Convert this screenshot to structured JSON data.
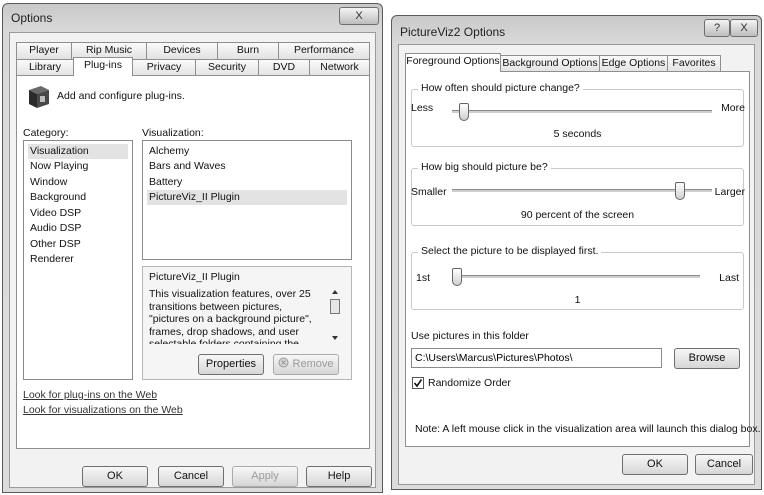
{
  "options": {
    "title": "Options",
    "close_glyph": "X",
    "tabs_back": [
      "Player",
      "Rip Music",
      "Devices",
      "Burn",
      "Performance"
    ],
    "tabs_front": [
      "Library",
      "Plug-ins",
      "Privacy",
      "Security",
      "DVD",
      "Network"
    ],
    "active_tab": "Plug-ins",
    "header_text": "Add and configure plug-ins.",
    "category_label": "Category:",
    "categories": [
      "Visualization",
      "Now Playing",
      "Window",
      "Background",
      "Video DSP",
      "Audio DSP",
      "Other DSP",
      "Renderer"
    ],
    "selected_category": "Visualization",
    "visualization_label": "Visualization:",
    "visualizations": [
      "Alchemy",
      "Bars and Waves",
      "Battery",
      "PictureViz_II Plugin"
    ],
    "selected_visualization": "PictureViz_II Plugin",
    "detail_title": "PictureViz_II Plugin",
    "detail_text": "This visualization features, over 25 transitions between pictures, \"pictures on a background picture\", frames, drop shadows, and user selectable folders containing the pictures to be displayed.",
    "properties_button": "Properties",
    "remove_button": "Remove",
    "link_plugins": "Look for plug-ins on the Web",
    "link_visualizations": "Look for visualizations on the Web",
    "ok": "OK",
    "cancel": "Cancel",
    "apply": "Apply",
    "help": "Help"
  },
  "pictureviz": {
    "title": "PictureViz2 Options",
    "help_glyph": "?",
    "close_glyph": "X",
    "tabs": [
      "Foreground Options",
      "Background Options",
      "Edge Options",
      "Favorites"
    ],
    "active_tab": "Foreground Options",
    "change": {
      "label": "How often should picture change?",
      "min_label": "Less",
      "max_label": "More",
      "value_text": "5 seconds",
      "position": 0.03
    },
    "size": {
      "label": "How big should picture be?",
      "min_label": "Smaller",
      "max_label": "Larger",
      "value_text": "90 percent of the screen",
      "position": 0.9
    },
    "first": {
      "label": "Select the picture to be displayed first.",
      "min_label": "1st",
      "max_label": "Last",
      "value_text": "1",
      "position": 0.0
    },
    "folder_label": "Use pictures in this folder",
    "folder_value": "C:\\Users\\Marcus\\Pictures\\Photos\\",
    "browse": "Browse",
    "randomize_label": "Randomize Order",
    "randomize_checked": true,
    "note": "Note: A left mouse click in the visualization area will launch this dialog box.",
    "ok": "OK",
    "cancel": "Cancel"
  }
}
